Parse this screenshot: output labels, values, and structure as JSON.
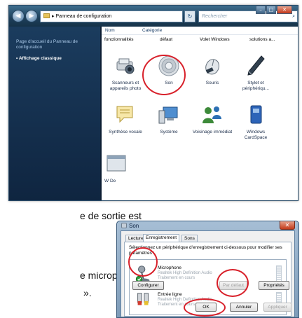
{
  "background_text": {
    "line1": "e de sortie est",
    "line2": "e microphone",
    "line3": "»."
  },
  "control_panel": {
    "address": "Panneau de configuration",
    "address_arrow": "▸",
    "search_placeholder": "Rechercher",
    "nav_back": "◀",
    "nav_forward": "▶",
    "left_pane": {
      "home_link": "Page d'accueil du Panneau de configuration",
      "classic_view": "•  Affichage classique"
    },
    "columns": {
      "name": "Nom",
      "category": "Catégorie"
    },
    "category_row": [
      "fonctionnalités",
      "défaut",
      "Volet Windows",
      "solutions a..."
    ],
    "items": [
      {
        "label": "Scanneurs et appareils photo",
        "icon": "scanner-icon"
      },
      {
        "label": "Son",
        "icon": "speaker-icon"
      },
      {
        "label": "Souris",
        "icon": "mouse-icon"
      },
      {
        "label": "Stylet et périphériqu...",
        "icon": "pen-icon"
      },
      {
        "label": "Synthèse vocale",
        "icon": "speech-icon"
      },
      {
        "label": "Système",
        "icon": "computer-icon"
      },
      {
        "label": "Voisinage immédiat",
        "icon": "people-icon"
      },
      {
        "label": "Windows CardSpace",
        "icon": "cardspace-icon"
      }
    ],
    "partial_item": "W De"
  },
  "son_dialog": {
    "title": "Son",
    "close": "✕",
    "tabs": [
      "Lecture",
      "Enregistrement",
      "Sons"
    ],
    "active_tab": "Enregistrement",
    "instruction": "Sélectionnez un périphérique d'enregistrement ci-dessous pour modifier ses paramètres :",
    "devices": [
      {
        "name": "Microphone",
        "driver": "Realtek High Definition Audio",
        "status": "Traitement en cours",
        "icon": "microphone-icon",
        "default": true
      },
      {
        "name": "Entrée ligne",
        "driver": "Realtek High Definition Audio",
        "status": "Traitement en cours",
        "icon": "line-in-icon",
        "default": false
      }
    ],
    "buttons": {
      "configure": "Configurer",
      "set_default": "Par défaut",
      "properties": "Propriétés",
      "ok": "OK",
      "cancel": "Annuler",
      "apply": "Appliquer"
    }
  },
  "colors": {
    "highlight_ring": "#d8202a",
    "vista_glass": "#1d3f5a"
  }
}
